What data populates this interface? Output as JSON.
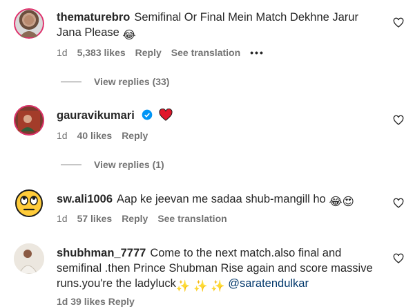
{
  "comments": [
    {
      "username": "thematurebro",
      "text": "Semifinal Or Final Mein Match Dekhne Jarur Jana Please",
      "emoji": "😂",
      "time": "1d",
      "likes": "5,383 likes",
      "reply": "Reply",
      "translate": "See translation",
      "more": "•••",
      "view_replies": "View replies (33)"
    },
    {
      "username": "gauravikumari",
      "verified": true,
      "emoji": "❤️",
      "time": "1d",
      "likes": "40 likes",
      "reply": "Reply",
      "view_replies": "View replies (1)"
    },
    {
      "username": "sw.ali1006",
      "text": "Aap ke jeevan me sadaa shub-mangill ho",
      "emoji": "😂😍",
      "time": "1d",
      "likes": "57 likes",
      "reply": "Reply",
      "translate": "See translation"
    },
    {
      "username": "shubhman_7777",
      "text": "Come to the next match.also final and semifinal .then Prince Shubman Rise again and score massive runs.you're the ladyluck",
      "emoji": "✨ ✨ ✨",
      "mention": "@saratendulkar",
      "partial_meta": "1d   39 likes   Reply"
    }
  ],
  "colors": {
    "text": "#262626",
    "secondary": "#737373",
    "mention": "#00376b",
    "verified": "#0095f6",
    "heart": "#e0162b"
  }
}
